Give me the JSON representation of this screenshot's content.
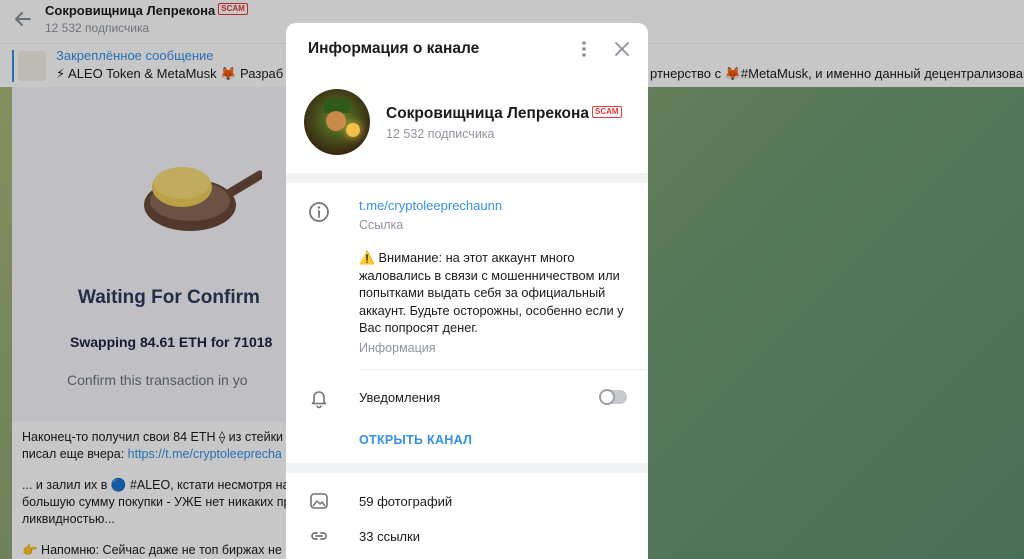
{
  "chat": {
    "title": "Сокровищница Лепрекона",
    "scam_badge": "SCAM",
    "subscribers": "12 532 подписчика",
    "pinned_label": "Закреплённое сообщение",
    "pinned_text": "⚡ ALEO Token & MetaMusk 🦊 Разраб",
    "pinned_text_right": "ртнерство с 🦊#MetaMusk, и именно данный децентрализованны"
  },
  "message": {
    "image_title": "Waiting For Confirm",
    "image_swap": "Swapping 84.61 ETH for 71018",
    "image_confirm": "Confirm this transaction in yo",
    "line1": "Наконец-то получил свои 84 ETH ⟠ из стейки",
    "line2_prefix": "писал еще вчера: ",
    "line2_link": "https://t.me/cryptoleeprecha",
    "line3": "... и залил их в 🔵 #ALEO, кстати несмотря на д",
    "line4": "большую сумму покупки - УЖЕ нет никаких пр",
    "line5": "ликвидностью...",
    "line6": "👉 Напомню: Сейчас даже не топ биржах не"
  },
  "dialog": {
    "title": "Информация о канале",
    "channel_name": "Сокровищница Лепрекона",
    "scam_badge": "SCAM",
    "subscribers": "12 532 подписчика",
    "link": "t.me/cryptoleeprechaunn",
    "link_caption": "Ссылка",
    "info_text": "⚠️ Внимание: на этот аккаунт много жаловались в связи с мошенничеством или попытками выдать себя за официальный аккаунт. Будьте осторожны, особенно если у Вас попросят денег.",
    "info_caption": "Информация",
    "notifications_label": "Уведомления",
    "notifications_on": false,
    "open_channel": "ОТКРЫТЬ КАНАЛ",
    "photos": "59 фотографий",
    "links": "33 ссылки"
  }
}
